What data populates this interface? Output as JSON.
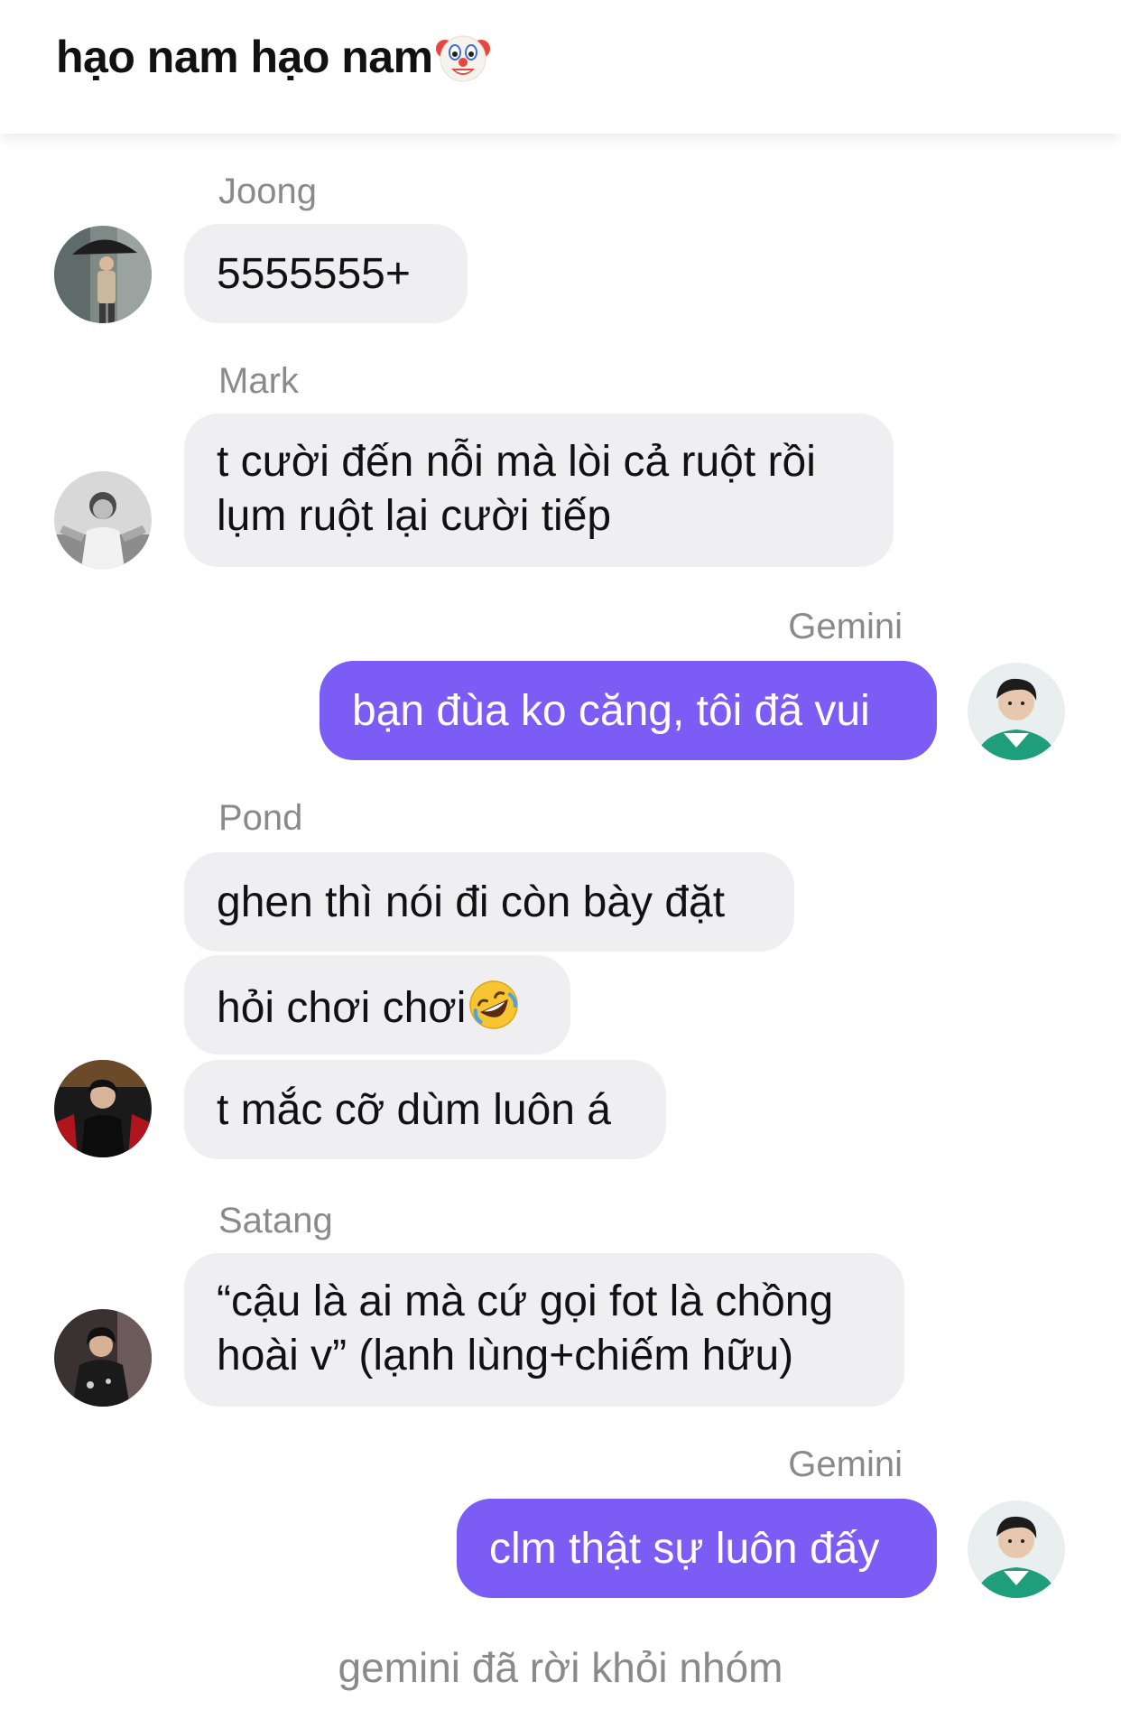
{
  "chat": {
    "title": "hạo nam hạo nam",
    "title_emoji": "clown-face"
  },
  "messages": [
    {
      "sender": "Joong",
      "text": "5555555+"
    },
    {
      "sender": "Mark",
      "lines": [
        "t cười đến nỗi mà lòi cả ruột rồi",
        "lụm ruột lại cười tiếp"
      ]
    },
    {
      "sender": "Gemini",
      "text": "bạn đùa ko căng, tôi đã vui"
    },
    {
      "sender": "Pond",
      "texts": [
        "ghen thì nói đi còn bày đặt",
        "hỏi chơi chơi",
        "t mắc cỡ dùm luôn á"
      ]
    },
    {
      "sender": "Satang",
      "lines": [
        "“cậu là ai mà cứ gọi fot là chồng",
        "hoài v” (lạnh lùng+chiếm hữu)"
      ]
    },
    {
      "sender": "Gemini",
      "text": "clm thật sự luôn đấy"
    }
  ],
  "system_message": "gemini đã rời khỏi nhóm",
  "colors": {
    "outgoing_bubble": "#7b5cf5",
    "incoming_bubble": "#efeff1",
    "sender_name": "#8a8a8e"
  }
}
